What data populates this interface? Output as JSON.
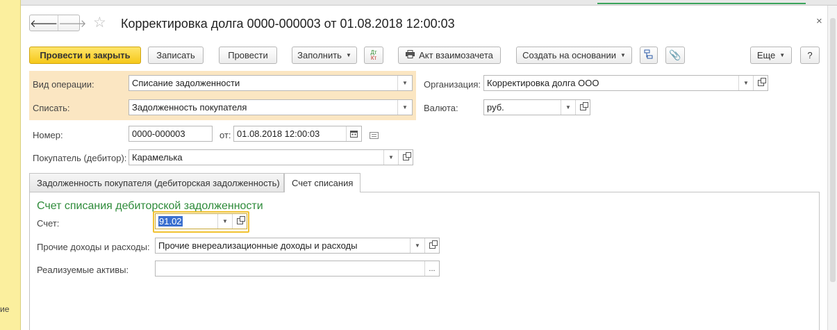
{
  "left_strip": {
    "fragment": "ие"
  },
  "header": {
    "back_label": "🡐",
    "forward_label": "🡒",
    "title": "Корректировка долга 0000-000003 от 01.08.2018 12:00:03",
    "close_label": "×"
  },
  "toolbar": {
    "post_close": "Провести и закрыть",
    "save": "Записать",
    "post": "Провести",
    "fill": "Заполнить",
    "dt": "Дт",
    "kt": "Кт",
    "print_act": "Акт взаимозачета",
    "create_based": "Создать на основании",
    "more": "Еще",
    "help": "?"
  },
  "form": {
    "operation_type_label": "Вид операции:",
    "operation_type_value": "Списание задолженности",
    "write_off_label": "Списать:",
    "write_off_value": "Задолженность покупателя",
    "organization_label": "Организация:",
    "organization_value": "Корректировка долга ООО",
    "currency_label": "Валюта:",
    "currency_value": "руб.",
    "number_label": "Номер:",
    "number_value": "0000-000003",
    "date_label": "от:",
    "date_value": "01.08.2018 12:00:03",
    "buyer_label": "Покупатель (дебитор):",
    "buyer_value": "Карамелька"
  },
  "tabs": [
    {
      "label": "Задолженность покупателя (дебиторская задолженность)",
      "active": false
    },
    {
      "label": "Счет списания",
      "active": true
    }
  ],
  "panel": {
    "section_title": "Счет списания дебиторской задолженности",
    "account_label": "Счет:",
    "account_value": "91.02",
    "income_expense_label": "Прочие доходы и расходы:",
    "income_expense_value": "Прочие внереализационные доходы и расходы",
    "assets_label": "Реализуемые активы:",
    "assets_value": "",
    "assets_button": "..."
  },
  "colors": {
    "primary_button": "#f6c81a",
    "highlight_area": "#fbe6c2",
    "section_title": "#2e8b3a",
    "focus_border": "#f1c232",
    "selection": "#3a6fd0"
  }
}
